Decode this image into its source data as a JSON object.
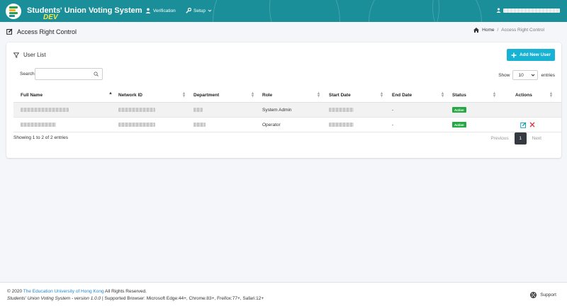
{
  "header": {
    "title": "Students' Union Voting System",
    "env_tag": "DEV",
    "nav": [
      {
        "label": "Verification",
        "icon": "user-check-icon"
      },
      {
        "label": "Setup",
        "icon": "wrench-icon",
        "has_dropdown": true
      }
    ],
    "user_menu": {
      "icon": "user-avatar-icon"
    }
  },
  "page": {
    "title": "Access Right Control",
    "breadcrumb": {
      "home": "Home",
      "separator": "/",
      "current": "Access Right Control"
    }
  },
  "card": {
    "title": "User List",
    "add_button": "Add New User",
    "search_label": "Search:",
    "search_placeholder": "",
    "show_label": "Show",
    "page_length": "10",
    "entries_label": "entries",
    "columns": [
      "Full Name",
      "Network ID",
      "Department",
      "Role",
      "Start Date",
      "End Date",
      "Status",
      "Actions"
    ],
    "rows": [
      {
        "role": "System Admin",
        "end_date": "-",
        "status": "Active",
        "actions": []
      },
      {
        "role": "Operator",
        "end_date": "-",
        "status": "Active",
        "actions": [
          "edit",
          "delete"
        ]
      }
    ],
    "info": "Showing 1 to 2 of 2 entries",
    "pagination": {
      "previous": "Previous",
      "current": "1",
      "next": "Next"
    }
  },
  "footer": {
    "copyright_prefix": "© 2020",
    "institution": "The Education University of Hong Kong",
    "copyright_suffix": "All Rights Reserved.",
    "version_text": "Students' Union Voting System - version 1.0.0",
    "browser_support": "| Supported Browser: Microsoft Edge:44+, Chrome:83+, Freifox:77+, Safari:12+",
    "support_label": "Support"
  },
  "colors": {
    "header_bg": "#1a8f99",
    "accent": "#17b2d4",
    "dev_tag": "#f3e94a",
    "status_active": "#28a745",
    "link": "#1f8ad3"
  }
}
